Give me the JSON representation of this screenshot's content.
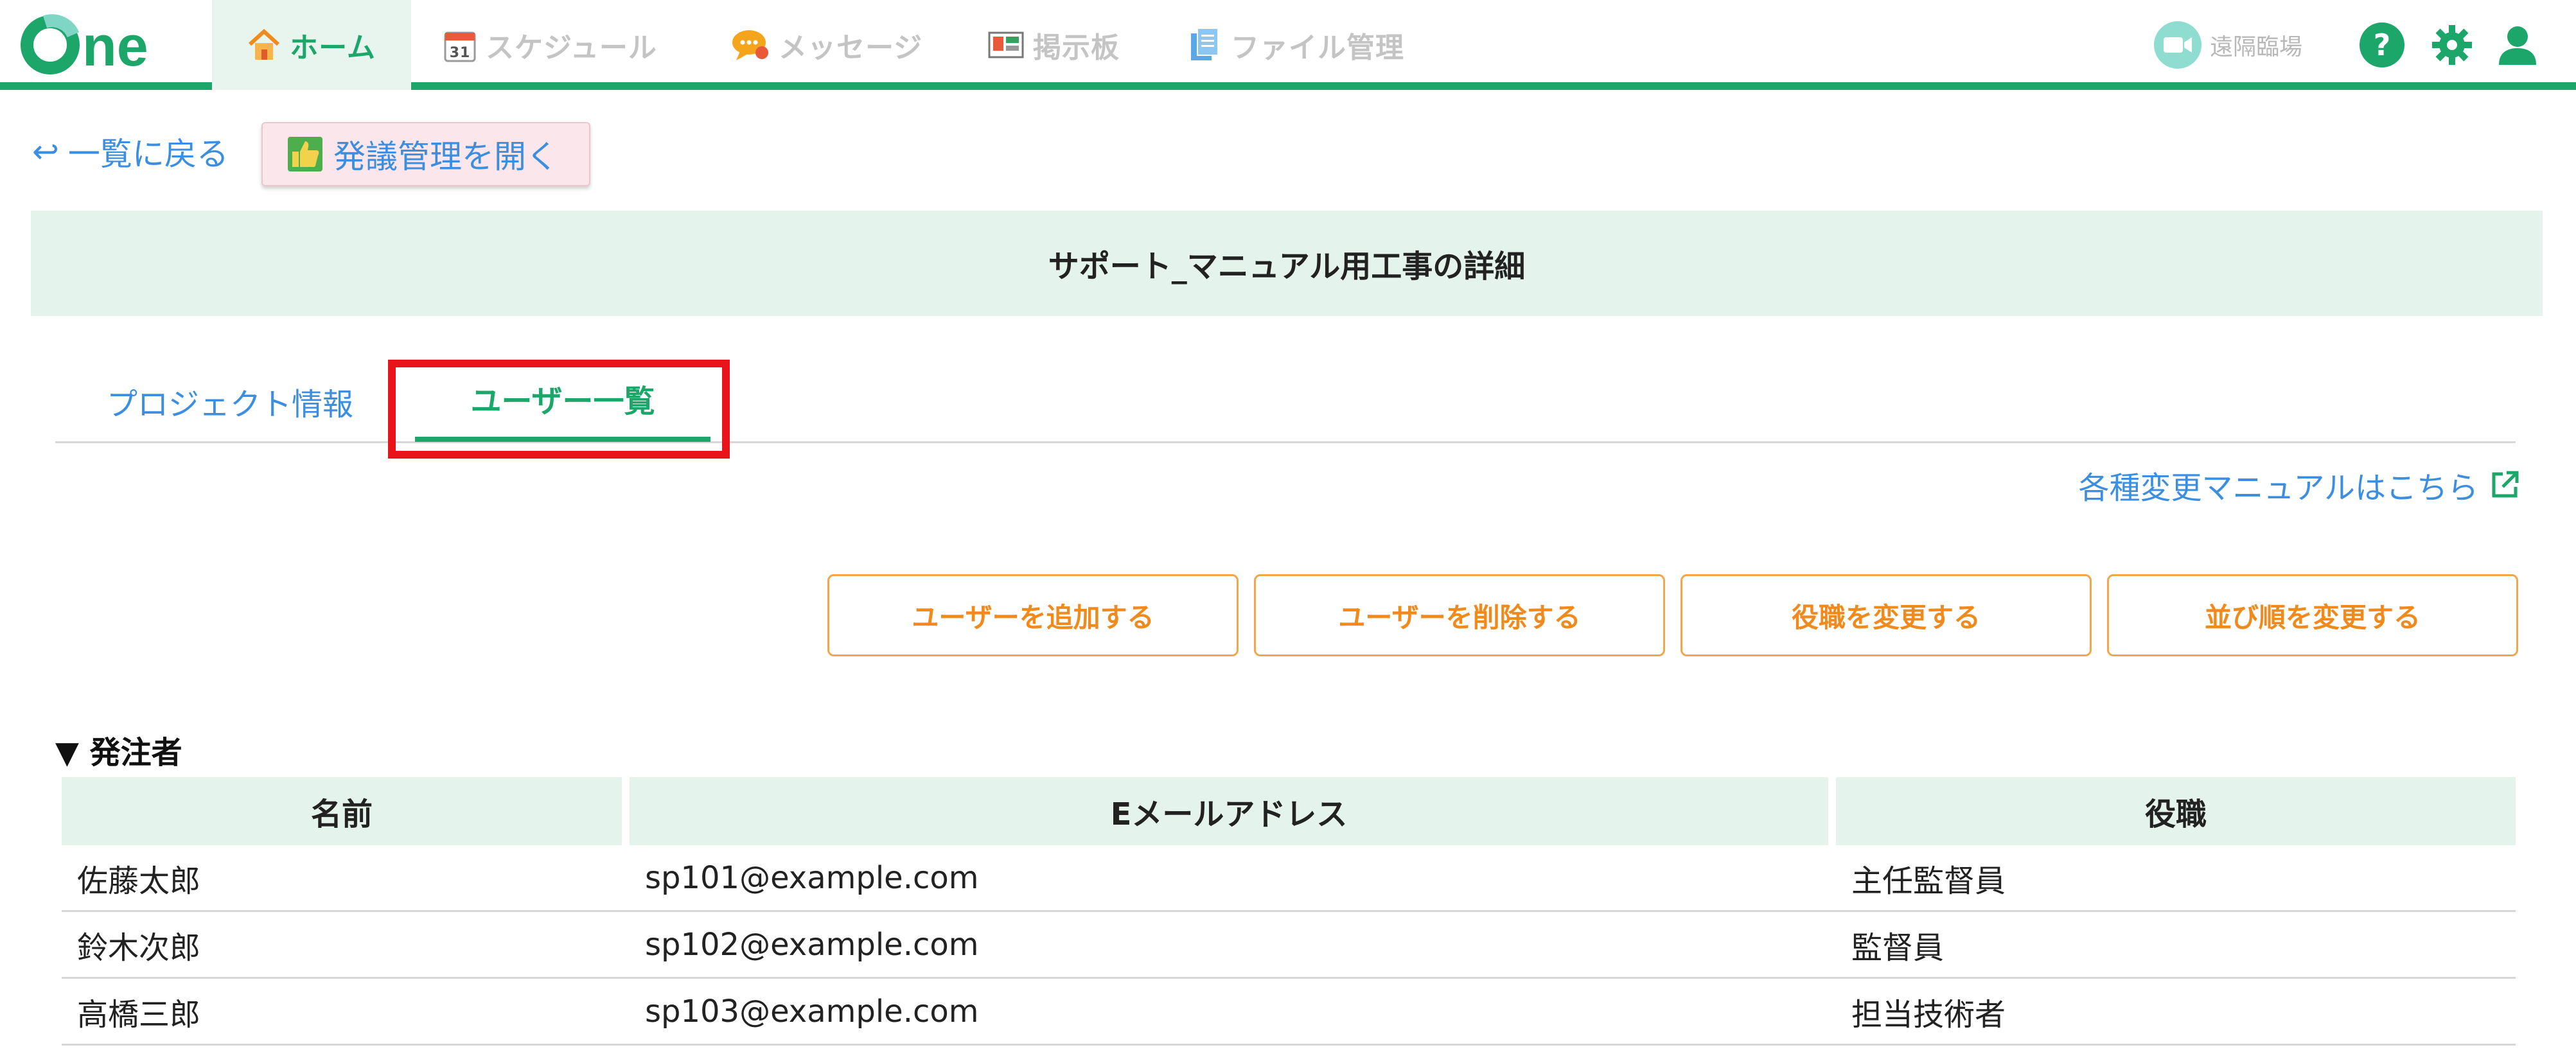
{
  "nav": {
    "logo_text": "One",
    "items": [
      {
        "label": "ホーム",
        "icon": "house-icon",
        "active": true
      },
      {
        "label": "スケジュール",
        "icon": "calendar-icon",
        "active": false
      },
      {
        "label": "メッセージ",
        "icon": "chat-bubble-icon",
        "active": false
      },
      {
        "label": "掲示板",
        "icon": "board-icon",
        "active": false
      },
      {
        "label": "ファイル管理",
        "icon": "file-icon",
        "active": false
      }
    ],
    "calendar_day": "31",
    "remote_label": "遠隔臨場"
  },
  "toolbar": {
    "back_label": "一覧に戻る",
    "proposal_label": "発議管理を開く"
  },
  "page_title": "サポート_マニュアル用工事の詳細",
  "tabs": {
    "project": "プロジェクト情報",
    "users": "ユーザー一覧"
  },
  "manual_link": "各種変更マニュアルはこちら",
  "actions": {
    "add": "ユーザーを追加する",
    "delete": "ユーザーを削除する",
    "role": "役職を変更する",
    "order": "並び順を変更する"
  },
  "section": {
    "label": "発注者"
  },
  "table": {
    "headers": [
      "名前",
      "Eメールアドレス",
      "役職"
    ],
    "rows": [
      [
        "佐藤太郎",
        "sp101@example.com",
        "主任監督員"
      ],
      [
        "鈴木次郎",
        "sp102@example.com",
        "監督員"
      ],
      [
        "高橋三郎",
        "sp103@example.com",
        "担当技術者"
      ]
    ]
  },
  "colors": {
    "brand_green": "#1ca66a",
    "link_blue": "#3c8fe0",
    "action_orange": "#f08a1c",
    "highlight_red": "#e8141a",
    "banner_bg": "#e4f4ec"
  }
}
